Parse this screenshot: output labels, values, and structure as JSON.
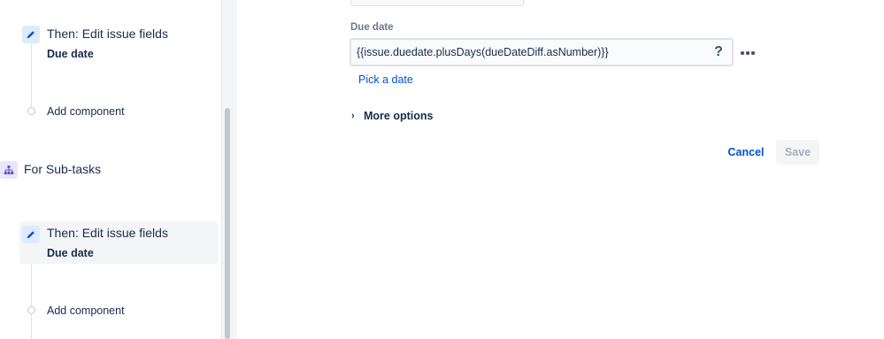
{
  "sidebar": {
    "steps": [
      {
        "title": "Then: Edit issue fields",
        "subtitle": "Due date"
      },
      {
        "add_label": "Add component"
      },
      {
        "branch_label": "For Sub-tasks"
      },
      {
        "title": "Then: Edit issue fields",
        "subtitle": "Due date",
        "selected": true
      },
      {
        "add_label": "Add component"
      }
    ]
  },
  "form": {
    "field_label": "Due date",
    "field_value": "{{issue.duedate.plusDays(dueDateDiff.asNumber)}}",
    "help_glyph": "?",
    "pick_date_link": "Pick a date",
    "more_options_label": "More options",
    "more_options_chevron": "›",
    "cancel_label": "Cancel",
    "save_label": "Save"
  },
  "icons": {
    "edit": "pencil-icon",
    "branch": "branch-icon",
    "more": "more-icon",
    "help": "question-icon"
  },
  "colors": {
    "accent": "#0052cc",
    "edit_icon_bg": "#deebff",
    "branch_icon_bg": "#eae6ff",
    "selected_bg": "#f4f5f7"
  }
}
